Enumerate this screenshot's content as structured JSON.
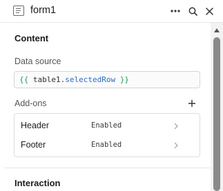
{
  "header": {
    "title": "form1",
    "icons": {
      "component": "form-component-icon",
      "more": "more-horizontal-icon",
      "search": "search-icon",
      "close": "close-icon"
    }
  },
  "content": {
    "section_title": "Content",
    "data_source": {
      "label": "Data source",
      "value_open": "{{",
      "value_object": "table1.",
      "value_property": "selectedRow",
      "value_close": "}}"
    },
    "addons": {
      "label": "Add-ons",
      "add_icon": "plus-icon",
      "items": [
        {
          "name": "Header",
          "status": "Enabled"
        },
        {
          "name": "Footer",
          "status": "Enabled"
        }
      ]
    }
  },
  "interaction": {
    "section_title": "Interaction"
  },
  "colors": {
    "brace": "#1fa35f",
    "property": "#2b6cc4",
    "border": "#dddddd",
    "scroll_thumb": "#8a8a8a"
  }
}
